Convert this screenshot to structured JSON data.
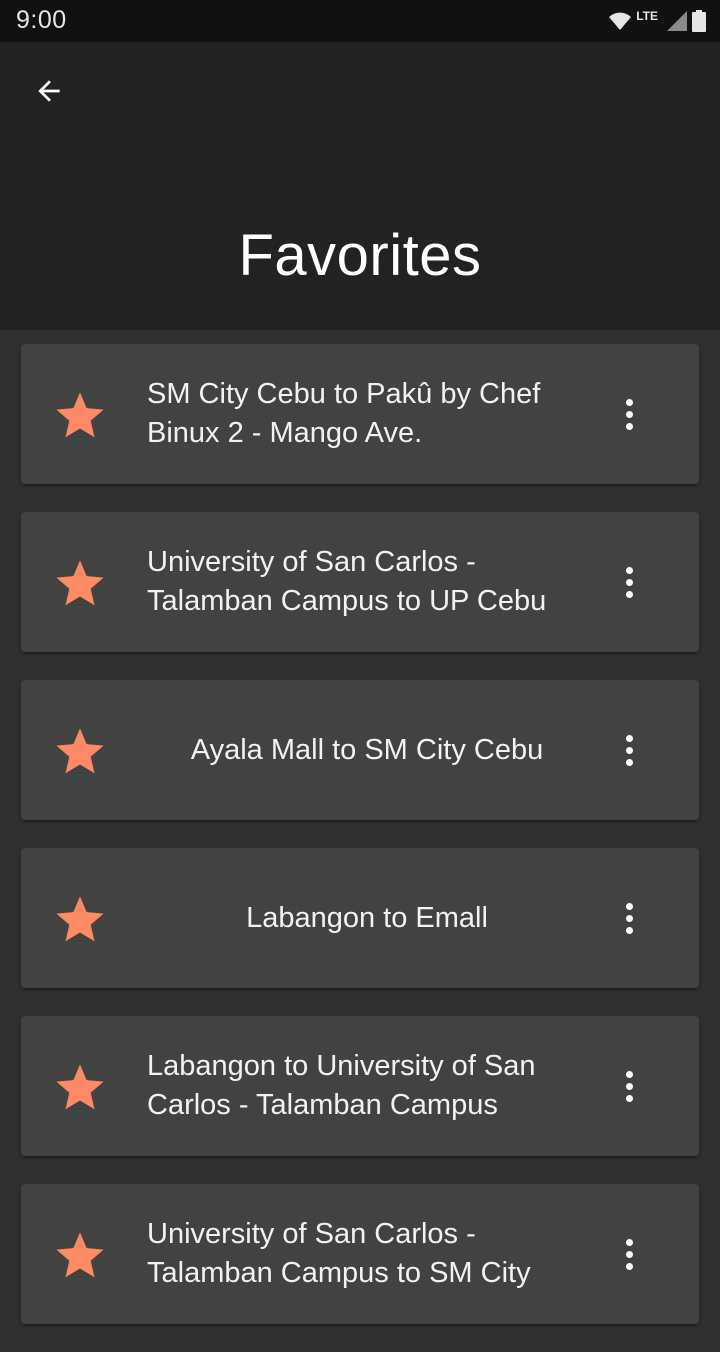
{
  "status_bar": {
    "time": "9:00",
    "network": "LTE"
  },
  "header": {
    "title": "Favorites"
  },
  "favorites": [
    {
      "label": "SM City Cebu to Pakû by Chef Binux 2 - Mango Ave."
    },
    {
      "label": "University of San Carlos - Talamban Campus to UP Cebu"
    },
    {
      "label": "Ayala Mall to SM City Cebu"
    },
    {
      "label": "Labangon to Emall"
    },
    {
      "label": "Labangon to University of San Carlos - Talamban Campus"
    },
    {
      "label": "University of San Carlos - Talamban Campus to SM City"
    }
  ],
  "colors": {
    "star": "#ff8a65",
    "card": "#424242",
    "background": "#303030",
    "app_bar": "#222222"
  }
}
